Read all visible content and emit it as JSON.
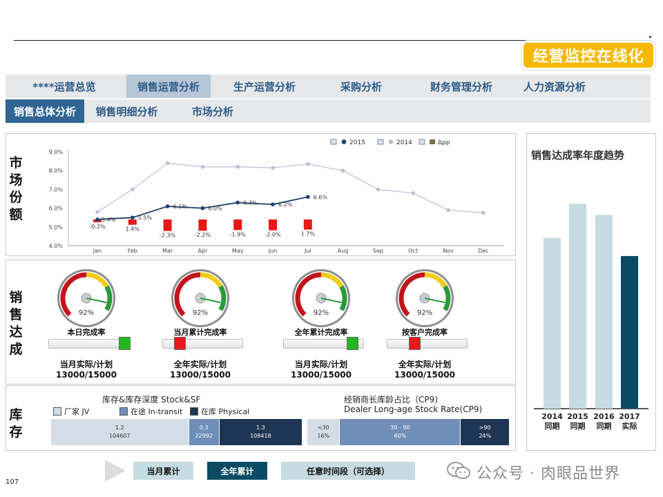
{
  "brand": "经营监控在线化",
  "page_number": "107",
  "nav_primary": [
    {
      "label": "****运营总览",
      "active": false
    },
    {
      "label": "销售运营分析",
      "active": true
    },
    {
      "label": "生产运营分析",
      "active": false
    },
    {
      "label": "采购分析",
      "active": false
    },
    {
      "label": "财务管理分析",
      "active": false
    },
    {
      "label": "人力资源分析",
      "active": false
    }
  ],
  "nav_secondary": [
    {
      "label": "销售总体分析",
      "active": true
    },
    {
      "label": "销售明细分析",
      "active": false
    },
    {
      "label": "市场分析",
      "active": false
    }
  ],
  "sections": {
    "market_share": "市场份额",
    "sales_achievement": "销售达成",
    "inventory": "库存"
  },
  "chart_data": [
    {
      "type": "line",
      "legend": [
        "2015",
        "2014",
        "Δpp"
      ],
      "categories": [
        "Jan",
        "Feb",
        "Mar",
        "Apr",
        "May",
        "Jun",
        "Jul",
        "Aug",
        "Sep",
        "Oct",
        "Nov",
        "Dec"
      ],
      "ylim": [
        4.0,
        9.0
      ],
      "y_ticks": [
        "4.0%",
        "5.0%",
        "6.0%",
        "7.0%",
        "8.0%",
        "9.0%"
      ],
      "series": [
        {
          "name": "2015",
          "values": [
            5.4,
            5.5,
            6.1,
            6.0,
            6.3,
            6.2,
            6.6,
            null,
            null,
            null,
            null,
            null
          ],
          "color": "#1f3e6b"
        },
        {
          "name": "2014",
          "values": [
            5.8,
            7.0,
            8.4,
            8.2,
            8.2,
            8.15,
            8.35,
            8.0,
            7.0,
            6.8,
            5.9,
            5.75
          ],
          "color": "#b8bfd2"
        }
      ],
      "line_labels": [
        "5.4%",
        "5.5%",
        "6.1%",
        "6.0%",
        "6.3%",
        "6.2%",
        "6.6%"
      ],
      "delta_pp": [
        -0.2,
        1.4,
        -2.3,
        -2.2,
        -1.9,
        -2.0,
        1.7
      ],
      "delta_labels": [
        "-0.2%",
        "1.4%",
        "-2.3%",
        "-2.2%",
        "-1.9%",
        "-2.0%",
        "1.7%"
      ],
      "delta_color": "#e81818"
    },
    {
      "type": "bar",
      "title": "销售达成率年度趋势",
      "categories": [
        {
          "year": "2014",
          "kind": "同期"
        },
        {
          "year": "2015",
          "kind": "同期"
        },
        {
          "year": "2016",
          "kind": "同期"
        },
        {
          "year": "2017",
          "kind": "实际"
        }
      ],
      "values": [
        75,
        90,
        85,
        67
      ],
      "colors": [
        "#c7dbe2",
        "#c7dbe2",
        "#c7dbe2",
        "#0b4a63"
      ]
    }
  ],
  "gauges": [
    {
      "value": "92%",
      "label": "本日完成率",
      "knob": "green",
      "ratio_label": "当月实际/计划",
      "ratio_value": "13000/15000"
    },
    {
      "value": "92%",
      "label": "当月累计完成率",
      "knob": "red",
      "ratio_label": "全年实际/计划",
      "ratio_value": "13000/15000"
    },
    {
      "value": "92%",
      "label": "全年累计完成率",
      "knob": "green",
      "ratio_label": "当月实际/计划",
      "ratio_value": "13000/15000"
    },
    {
      "value": "92%",
      "label": "按客户完成率",
      "knob": "red",
      "ratio_label": "全年实际/计划",
      "ratio_value": "13000/15000"
    }
  ],
  "inventory": {
    "stock_title": "库存&库存深度 Stock&SF",
    "stock_legend": [
      {
        "label": "厂家 JV",
        "color": "#d4dde6"
      },
      {
        "label": "在途 In-transit",
        "color": "#6f8fb8"
      },
      {
        "label": "在库 Physical",
        "color": "#1e3553"
      }
    ],
    "stock_bar": [
      {
        "top": "1.2",
        "bottom": "104607",
        "color": "#d4dde6",
        "text": "#333",
        "share": 0.55
      },
      {
        "top": "0.3",
        "bottom": "22992",
        "color": "#6f8fb8",
        "text": "#fff",
        "share": 0.12
      },
      {
        "top": "1.3",
        "bottom": "108418",
        "color": "#1e3553",
        "text": "#fff",
        "share": 0.33
      }
    ],
    "cp9_title_cn": "经销商长库龄占比（CP9)",
    "cp9_title_en": "Dealer Long-age Stock Rate(CP9)",
    "cp9_bar": [
      {
        "top": "<30",
        "bottom": "16%",
        "color": "#d4dde6",
        "text": "#333",
        "share": 0.16
      },
      {
        "top": "30 - 90",
        "bottom": "60%",
        "color": "#6f8fb8",
        "text": "#fff",
        "share": 0.6
      },
      {
        "top": ">90",
        "bottom": "24%",
        "color": "#1e3553",
        "text": "#fff",
        "share": 0.24
      }
    ]
  },
  "buttons": {
    "month_cumulative": "当月累计",
    "year_cumulative": "全年累计",
    "custom_period": "任意时间段（可选择）"
  },
  "watermark": "公众号 · 肉眼品世界"
}
